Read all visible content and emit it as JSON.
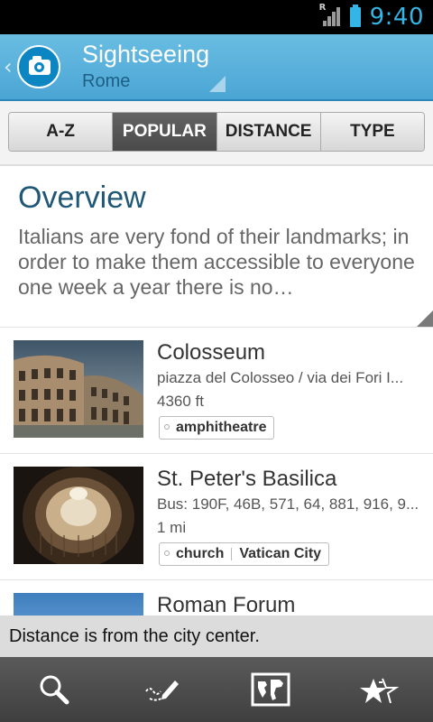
{
  "status_bar": {
    "time": "9:40",
    "network": "R"
  },
  "action_bar": {
    "title": "Sightseeing",
    "subtitle": "Rome",
    "app_icon": "camera-icon"
  },
  "tabs": [
    {
      "label": "A-Z",
      "active": false
    },
    {
      "label": "POPULAR",
      "active": true
    },
    {
      "label": "DISTANCE",
      "active": false
    },
    {
      "label": "TYPE",
      "active": false
    }
  ],
  "overview": {
    "title": "Overview",
    "text": "Italians are very fond of their landmarks; in order to make them accessible to everyone one week a year there is no…"
  },
  "places": [
    {
      "title": "Colosseum",
      "address": "piazza del Colosseo / via dei Fori I...",
      "distance": "4360 ft",
      "tags": [
        "amphitheatre"
      ]
    },
    {
      "title": "St. Peter's Basilica",
      "address": "Bus: 190F, 46B, 571, 64, 881, 916, 9...",
      "distance": "1 mi",
      "tags": [
        "church",
        "Vatican City"
      ]
    },
    {
      "title": "Roman Forum",
      "address": "",
      "distance": "",
      "tags": []
    }
  ],
  "toast": "Distance is from the city center.",
  "bottom_nav": [
    "search-icon",
    "edit-note-icon",
    "map-icon",
    "favorites-star-icon"
  ],
  "colors": {
    "accent": "#33b5e5",
    "action_bar": "#4ba5d4",
    "title": "#1f5776",
    "active_tab": "#4a4a4a"
  }
}
